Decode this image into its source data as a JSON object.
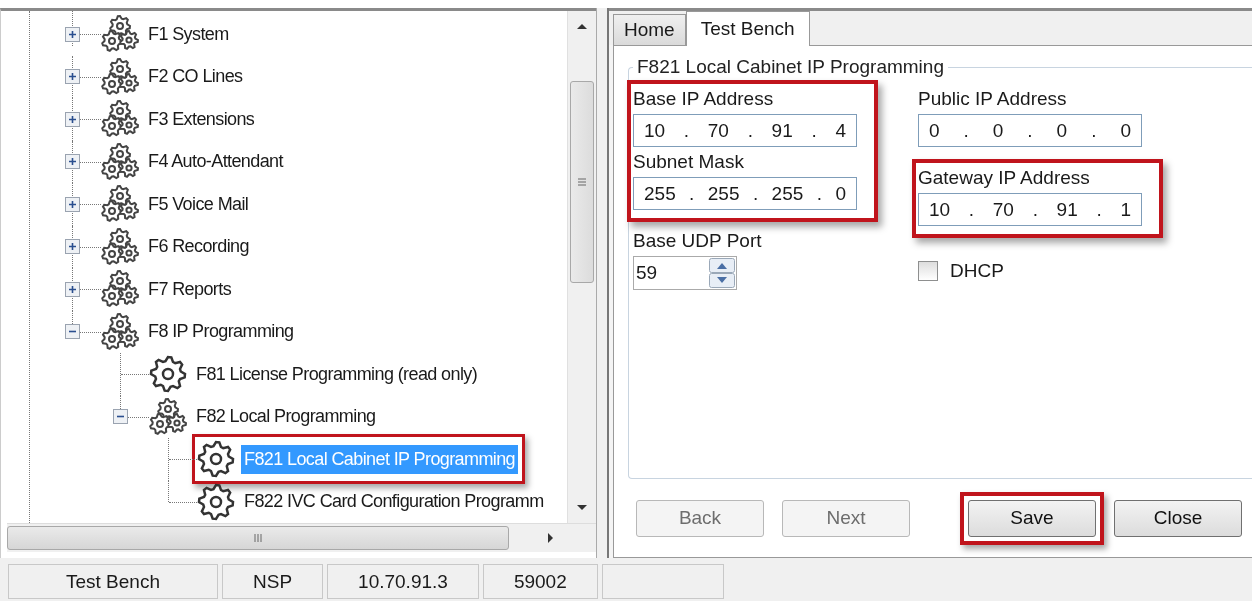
{
  "tree": {
    "items": [
      {
        "label": "F1 System",
        "kind": "group",
        "expanded": false,
        "selected": false,
        "highlighted": false
      },
      {
        "label": "F2 CO Lines",
        "kind": "group",
        "expanded": false,
        "selected": false,
        "highlighted": false
      },
      {
        "label": "F3 Extensions",
        "kind": "group",
        "expanded": false,
        "selected": false,
        "highlighted": false
      },
      {
        "label": "F4 Auto-Attendant",
        "kind": "group",
        "expanded": false,
        "selected": false,
        "highlighted": false
      },
      {
        "label": "F5 Voice Mail",
        "kind": "group",
        "expanded": false,
        "selected": false,
        "highlighted": false
      },
      {
        "label": "F6 Recording",
        "kind": "group",
        "expanded": false,
        "selected": false,
        "highlighted": false
      },
      {
        "label": "F7 Reports",
        "kind": "group",
        "expanded": false,
        "selected": false,
        "highlighted": false
      },
      {
        "label": "F8 IP Programming",
        "kind": "group",
        "expanded": true,
        "selected": false,
        "highlighted": false,
        "children": [
          {
            "label": "F81 License Programming (read only)",
            "kind": "leaf",
            "selected": false,
            "highlighted": false
          },
          {
            "label": "F82 Local Programming",
            "kind": "group",
            "expanded": true,
            "selected": false,
            "highlighted": false,
            "children": [
              {
                "label": "F821 Local Cabinet IP Programming",
                "kind": "leaf",
                "selected": true,
                "highlighted": true
              },
              {
                "label": "F822 IVC Card Configuration Programm",
                "kind": "leaf",
                "selected": false,
                "highlighted": false
              }
            ]
          }
        ]
      }
    ]
  },
  "tabs": [
    {
      "label": "Home",
      "selected": false
    },
    {
      "label": "Test Bench",
      "selected": true
    }
  ],
  "form": {
    "title": "F821 Local Cabinet IP Programming",
    "columns": [
      [
        {
          "highlighted": true,
          "fields": [
            {
              "kind": "ip",
              "label": "Base IP Address",
              "separator": ".",
              "octets": [
                "10",
                "70",
                "91",
                "4"
              ]
            },
            {
              "kind": "ip",
              "label": "Subnet Mask",
              "separator": ".",
              "octets": [
                "255",
                "255",
                "255",
                "0"
              ]
            }
          ]
        },
        {
          "highlighted": false,
          "fields": [
            {
              "kind": "spin",
              "label": "Base UDP Port",
              "value": "59"
            }
          ]
        }
      ],
      [
        {
          "highlighted": false,
          "fields": [
            {
              "kind": "ip",
              "label": "Public IP Address",
              "separator": ".",
              "octets": [
                "0",
                "0",
                "0",
                "0"
              ]
            }
          ]
        },
        {
          "highlighted": true,
          "fields": [
            {
              "kind": "ip",
              "label": "Gateway IP Address",
              "separator": ".",
              "octets": [
                "10",
                "70",
                "91",
                "1"
              ]
            }
          ]
        },
        {
          "highlighted": false,
          "fields": [
            {
              "kind": "checkbox",
              "label": "DHCP",
              "checked": false
            }
          ]
        }
      ]
    ]
  },
  "buttons": [
    {
      "label": "Back",
      "disabled": true,
      "highlighted": false
    },
    {
      "label": "Next",
      "disabled": true,
      "highlighted": false
    },
    {
      "label": "Save",
      "disabled": false,
      "highlighted": true
    },
    {
      "label": "Close",
      "disabled": false,
      "highlighted": false
    }
  ],
  "status_bar": [
    "Test Bench",
    "NSP",
    "10.70.91.3",
    "59002"
  ]
}
